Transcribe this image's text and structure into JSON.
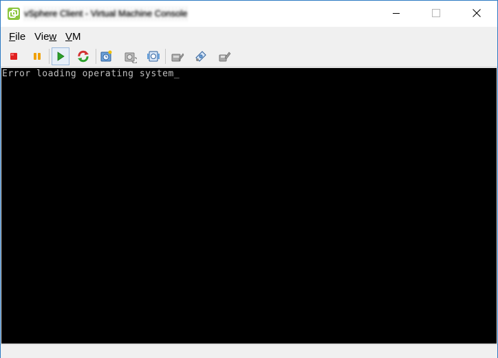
{
  "window": {
    "title": "vSphere Client - Virtual Machine Console",
    "controls": {
      "minimize_icon": "minimize-icon",
      "maximize_icon": "maximize-icon",
      "close_icon": "close-icon"
    }
  },
  "menu": {
    "file": {
      "first": "F",
      "rest": "ile"
    },
    "view": {
      "first": "Vie",
      "ul": "w",
      "rest": ""
    },
    "vm": {
      "ul": "V",
      "rest": "M"
    }
  },
  "toolbar": {
    "buttons": [
      {
        "icon": "power-off-icon",
        "color": "#e02020"
      },
      {
        "icon": "suspend-icon",
        "color": "#f0a000"
      },
      {
        "icon": "power-on-icon",
        "color": "#2ca02c",
        "pressed": true
      },
      {
        "icon": "reset-icon",
        "color": "#d23232"
      },
      {
        "icon": "snapshot-icon"
      },
      {
        "icon": "revert-snapshot-icon"
      },
      {
        "icon": "snapshot-manager-icon"
      },
      {
        "icon": "edit-settings-icon"
      },
      {
        "icon": "connect-cd-icon"
      },
      {
        "icon": "connect-floppy-icon"
      }
    ]
  },
  "console": {
    "line1": "Error loading operating system",
    "cursor": "_",
    "background": "#000000",
    "text_color": "#c0c0c0"
  }
}
